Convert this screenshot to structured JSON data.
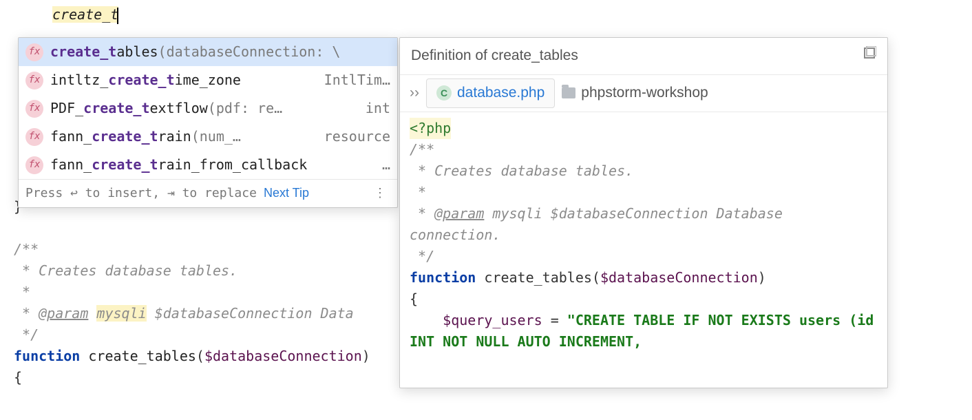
{
  "editor": {
    "typed_text": "create_t",
    "doc_block_1": "/**",
    "doc_line_1": " * Creates database tables.",
    "doc_line_2": " *",
    "doc_line_3_pre": " * ",
    "doc_param_tag": "@param",
    "doc_param_type": "mysqli",
    "doc_param_rest": " $databaseConnection Data",
    "doc_close": " */",
    "fn_kw": "function",
    "fn_name": " create_tables",
    "fn_sig_open": "(",
    "fn_arg": "$databaseConnection",
    "fn_sig_close": ")",
    "brace_open": "{",
    "brace_close": "}"
  },
  "completion": {
    "items": [
      {
        "match": "create_t",
        "rest": "ables",
        "sig": "(databaseConnection: \\",
        "ret": ""
      },
      {
        "pre": "intltz_",
        "match": "create_t",
        "rest": "ime_zone",
        "sig": "",
        "ret": "IntlTim…"
      },
      {
        "pre": "PDF_",
        "match": "create_t",
        "rest": "extflow",
        "sig": "(pdf: re…",
        "ret": "int"
      },
      {
        "pre": "fann_",
        "match": "create_t",
        "rest": "rain",
        "sig": "(num_…",
        "ret": "resource"
      },
      {
        "pre": "fann_",
        "match": "create_t",
        "rest": "rain_from_callback",
        "sig": "",
        "ret": "…"
      }
    ],
    "footer_hint": "Press ↩ to insert, ⇥ to replace",
    "next_tip": "Next Tip"
  },
  "definition": {
    "title": "Definition of create_tables",
    "file": "database.php",
    "project": "phpstorm-workshop",
    "code": {
      "php_open": "<?php",
      "doc_open": "/**",
      "doc_l1": " * Creates database tables.",
      "doc_l2": " *",
      "doc_l3_pre": " * ",
      "doc_param_tag": "@param",
      "doc_l3_rest": " mysqli $databaseConnection Database connection.",
      "doc_close": " */",
      "fn_kw": "function",
      "fn_name": " create_tables",
      "fn_open": "(",
      "fn_arg": "$databaseConnection",
      "fn_close": ")",
      "brace": "{",
      "body_indent": "    ",
      "query_var": "$query_users",
      "equals": " = ",
      "sql": "\"CREATE TABLE IF NOT EXISTS users (id INT NOT NULL AUTO INCREMENT,"
    }
  }
}
